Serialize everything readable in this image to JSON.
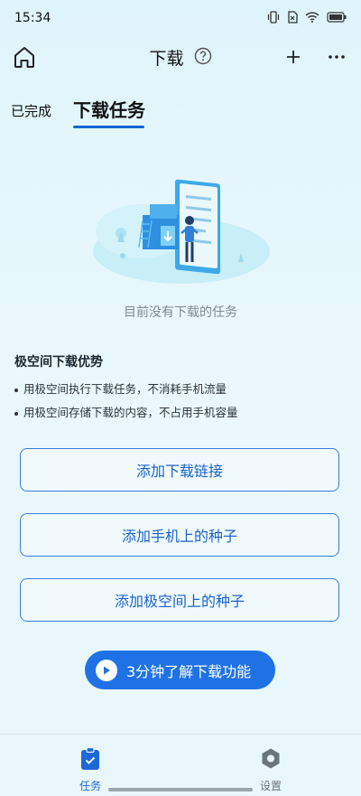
{
  "status_bar": {
    "time": "15:34"
  },
  "header": {
    "title": "下载"
  },
  "tabs": [
    {
      "label": "已完成",
      "active": false
    },
    {
      "label": "下载任务",
      "active": true
    }
  ],
  "empty_state": {
    "text": "目前没有下载的任务"
  },
  "advantages": {
    "title": "极空间下载优势",
    "items": [
      "用极空间执行下载任务，不消耗手机流量",
      "用极空间存储下载的内容，不占用手机容量"
    ]
  },
  "actions": {
    "add_link": "添加下载链接",
    "add_phone_torrent": "添加手机上的种子",
    "add_nas_torrent": "添加极空间上的种子"
  },
  "video_button": {
    "label": "3分钟了解下载功能"
  },
  "bottom_nav": {
    "tasks": "任务",
    "settings": "设置"
  },
  "colors": {
    "accent": "#1f72e6",
    "background": "#e4f6fb"
  }
}
